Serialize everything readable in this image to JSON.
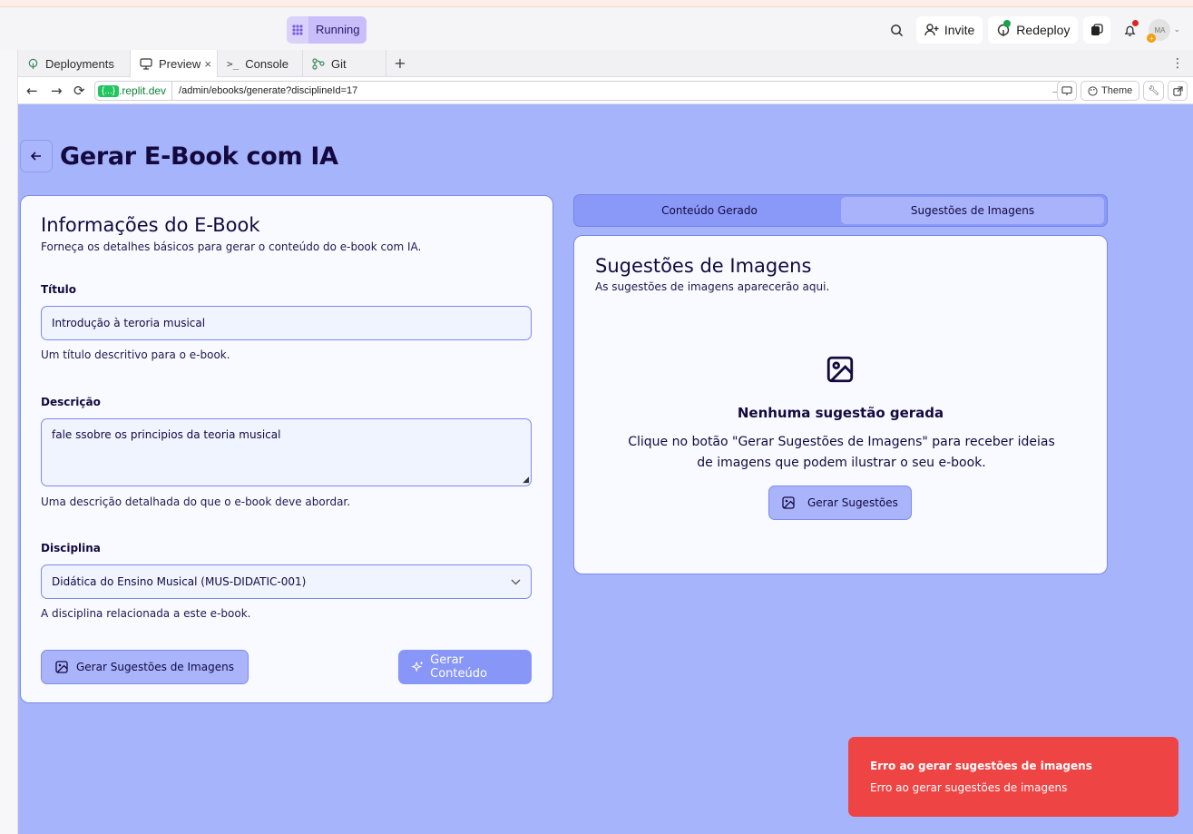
{
  "topbar": {
    "status_label": "Running",
    "invite_label": "Invite",
    "redeploy_label": "Redeploy",
    "avatar_initials": "MA"
  },
  "tabs": [
    {
      "label": "Deployments",
      "icon": "deploy-icon"
    },
    {
      "label": "Preview",
      "icon": "monitor-icon"
    },
    {
      "label": "Console",
      "icon": "terminal-icon"
    },
    {
      "label": "Git",
      "icon": "git-icon"
    }
  ],
  "url": {
    "domain_badge": "{...}",
    "host": ".replit.dev",
    "path": "/admin/ebooks/generate?disciplineId=17",
    "theme_label": "Theme"
  },
  "page": {
    "title": "Gerar E-Book com IA"
  },
  "form": {
    "card_title": "Informações do E-Book",
    "card_subtitle": "Forneça os detalhes básicos para gerar o conteúdo do e-book com IA.",
    "title_label": "Título",
    "title_value": "Introdução à teroria musical",
    "title_hint": "Um título descritivo para o e-book.",
    "description_label": "Descrição",
    "description_value": "fale ssobre os principios da teoria musical",
    "description_hint": "Uma descrição detalhada do que o e-book deve abordar.",
    "discipline_label": "Disciplina",
    "discipline_value": "Didática do Ensino Musical (MUS-DIDATIC-001)",
    "discipline_hint": "A disciplina relacionada a este e-book.",
    "suggest_images_button": "Gerar Sugestões de Imagens",
    "generate_content_button": "Gerar Conteúdo"
  },
  "right_tabs": {
    "content_tab": "Conteúdo Gerado",
    "images_tab": "Sugestões de Imagens"
  },
  "suggestions": {
    "card_title": "Sugestões de Imagens",
    "card_subtitle": "As sugestões de imagens aparecerão aqui.",
    "empty_title": "Nenhuma sugestão gerada",
    "empty_text": "Clique no botão \"Gerar Sugestões de Imagens\" para receber ideias de imagens que podem ilustrar o seu e-book.",
    "button_label": "Gerar Sugestões"
  },
  "toast": {
    "title": "Erro ao gerar sugestões de imagens",
    "description": "Erro ao gerar sugestões de imagens"
  },
  "colors": {
    "preview_bg": "#a6b4fb",
    "accent": "#8796f7",
    "error": "#ef4444",
    "text_dark": "#14093f"
  }
}
